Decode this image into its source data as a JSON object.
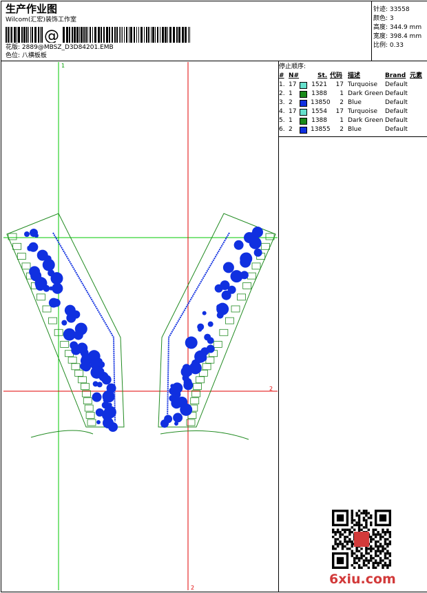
{
  "header": {
    "title": "生产作业图",
    "company": "Wilcom(汇宏)装饰工作室",
    "barcode_glyph": "@",
    "design_label": "花版:",
    "design_value": "2889@MBSZ_D3D84201.EMB",
    "colorpos_label": "色位:",
    "colorpos_value": "八横板板"
  },
  "stats": [
    {
      "label": "针迹:",
      "value": "33558"
    },
    {
      "label": "颜色:",
      "value": "3"
    },
    {
      "label": "高度:",
      "value": "344.9 mm"
    },
    {
      "label": "宽度:",
      "value": "398.4 mm"
    },
    {
      "label": "比例:",
      "value": "0.33"
    }
  ],
  "stop_sequence": {
    "title": "停止顺序:",
    "columns": [
      "#",
      "N#",
      "St.",
      "代码",
      "描述",
      "Brand",
      "元素"
    ],
    "rows": [
      {
        "idx": "1.",
        "needle": "17",
        "color": "#66e0cc",
        "stitches": "1521",
        "code": "17",
        "desc": "Turquoise",
        "brand": "Default"
      },
      {
        "idx": "2.",
        "needle": "1",
        "color": "#1a8a1a",
        "stitches": "1388",
        "code": "1",
        "desc": "Dark Green",
        "brand": "Default"
      },
      {
        "idx": "3.",
        "needle": "2",
        "color": "#1030e0",
        "stitches": "13850",
        "code": "2",
        "desc": "Blue",
        "brand": "Default"
      },
      {
        "idx": "4.",
        "needle": "17",
        "color": "#66e0cc",
        "stitches": "1554",
        "code": "17",
        "desc": "Turquoise",
        "brand": "Default"
      },
      {
        "idx": "5.",
        "needle": "1",
        "color": "#1a8a1a",
        "stitches": "1388",
        "code": "1",
        "desc": "Dark Green",
        "brand": "Default"
      },
      {
        "idx": "6.",
        "needle": "2",
        "color": "#1030e0",
        "stitches": "13855",
        "code": "2",
        "desc": "Blue",
        "brand": "Default"
      }
    ]
  },
  "guides": {
    "green_label": "1",
    "red_label": "2",
    "red_label_bottom": "2"
  },
  "colors": {
    "guide_green": "#00c800",
    "guide_red": "#e00000",
    "outline_green": "#208a20",
    "fill_blue": "#1030e0"
  },
  "watermark": "6xiu.com"
}
